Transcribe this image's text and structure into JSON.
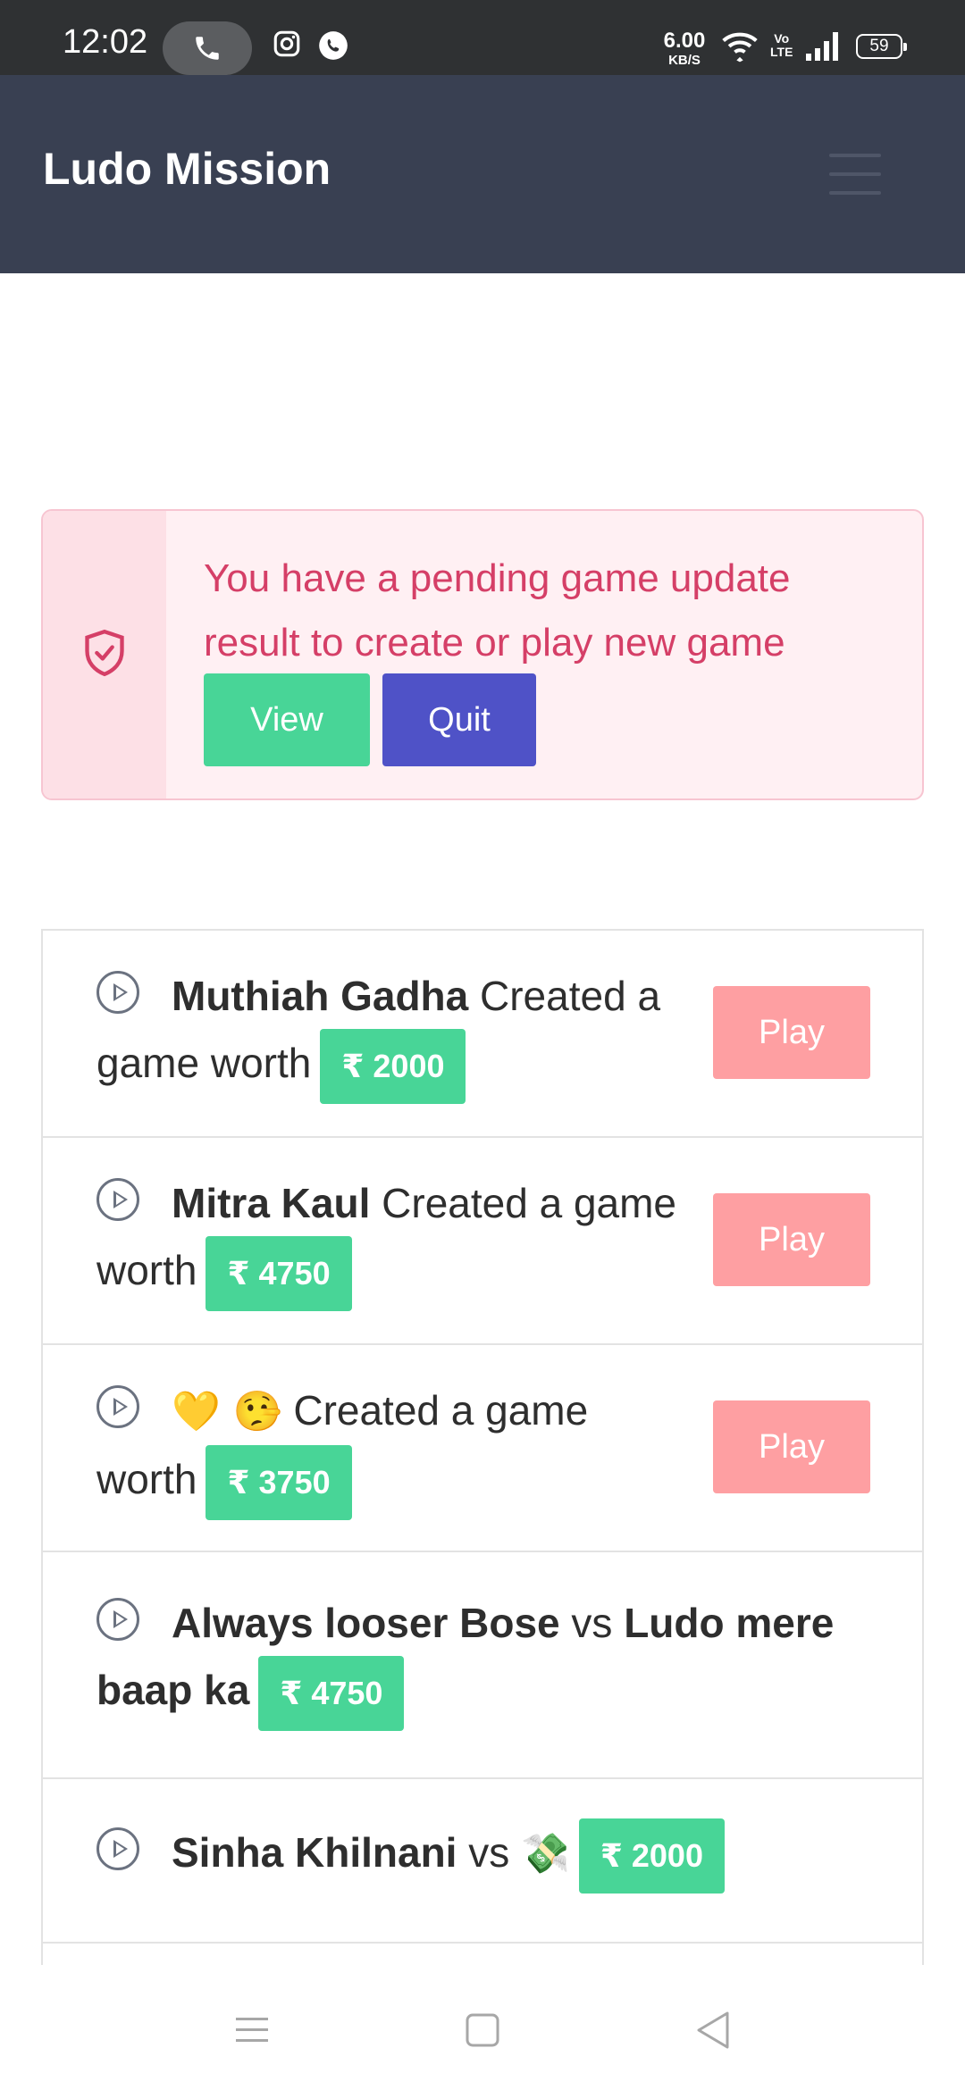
{
  "status_bar": {
    "time": "12:02",
    "net_speed_value": "6.00",
    "net_speed_unit": "KB/S",
    "volte_top": "Vo",
    "volte_bottom": "LTE",
    "battery": "59",
    "icons": [
      "call-pill-icon",
      "instagram-icon",
      "whatsapp-icon",
      "wifi-icon",
      "signal-icon",
      "battery-icon"
    ]
  },
  "header": {
    "title": "Ludo Mission",
    "menu_icon": "hamburger-menu-icon",
    "bg_color": "#394052"
  },
  "alert": {
    "icon": "shield-check-icon",
    "message": "You have a pending game update result to create or play new game",
    "view_label": "View",
    "quit_label": "Quit",
    "text_color": "#d53f67"
  },
  "games": [
    {
      "player": "Muthiah Gadha",
      "text": "Created a game worth",
      "amount": "₹ 2000",
      "action": "Play"
    },
    {
      "player": "Mitra Kaul",
      "text": "Created a game worth",
      "amount": "₹ 4750",
      "action": "Play"
    },
    {
      "player": "💛 🤥",
      "text": "Created a game worth",
      "amount": "₹ 3750",
      "action": "Play"
    },
    {
      "player1": "Always looser Bose",
      "vs": "vs",
      "player2": "Ludo mere baap ka",
      "amount": "₹ 4750"
    },
    {
      "player1": "Sinha Khilnani",
      "vs": "vs",
      "player2": "💸",
      "amount": "₹ 2000"
    }
  ],
  "colors": {
    "accent_green": "#48d597",
    "quit_blue": "#4f52c7",
    "play_pink": "#fe9fa2"
  },
  "nav_bar": {
    "icons": [
      "recent-apps-icon",
      "home-icon",
      "back-icon"
    ]
  }
}
